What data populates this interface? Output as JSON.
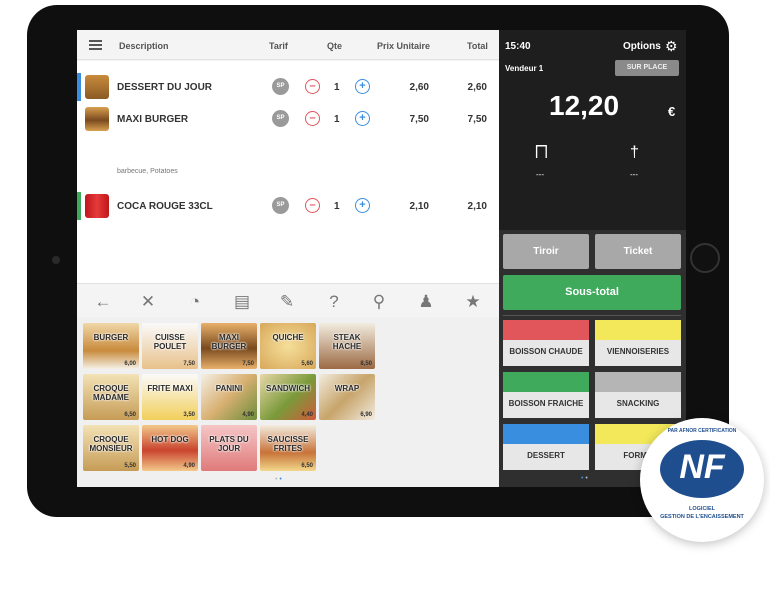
{
  "header": {
    "description": "Description",
    "tarif": "Tarif",
    "qte": "Qte",
    "prix_unitaire": "Prix Unitaire",
    "total": "Total"
  },
  "order": {
    "items": [
      {
        "name": "DESSERT DU JOUR",
        "tarif": "SP",
        "qty": "1",
        "unit": "2,60",
        "total": "2,60",
        "accent": "#3a8ee0"
      },
      {
        "name": "MAXI BURGER",
        "tarif": "SP",
        "qty": "1",
        "unit": "7,50",
        "total": "7,50",
        "note": "barbecue, Potatoes"
      },
      {
        "name": "COCA ROUGE 33CL",
        "tarif": "SP",
        "qty": "1",
        "unit": "2,10",
        "total": "2,10",
        "accent": "#3faa5c"
      }
    ]
  },
  "toolbar": [
    "arrow-left-icon",
    "close-icon",
    "timer-icon",
    "printer-icon",
    "pencil-icon",
    "question-icon",
    "search-icon",
    "person-icon",
    "star-icon"
  ],
  "products": [
    {
      "label": "BURGER",
      "price": "6,00"
    },
    {
      "label": "CUISSE POULET",
      "price": "7,50"
    },
    {
      "label": "MAXI BURGER",
      "price": "7,50"
    },
    {
      "label": "QUICHE",
      "price": "5,60"
    },
    {
      "label": "STEAK HACHE",
      "price": "8,50"
    },
    {
      "label": "CROQUE MADAME",
      "price": "6,50"
    },
    {
      "label": "FRITE MAXI",
      "price": "3,50"
    },
    {
      "label": "PANINI",
      "price": "4,90"
    },
    {
      "label": "SANDWICH",
      "price": "4,40"
    },
    {
      "label": "WRAP",
      "price": "6,90"
    },
    {
      "label": "CROQUE MONSIEUR",
      "price": "5,50"
    },
    {
      "label": "HOT DOG",
      "price": "4,90"
    },
    {
      "label": "PLATS DU JOUR",
      "price": ""
    },
    {
      "label": "SAUCISSE FRITES",
      "price": "6,50"
    }
  ],
  "right": {
    "time": "15:40",
    "options": "Options",
    "vendor": "Vendeur 1",
    "place": "SUR PLACE",
    "amount": "12,20",
    "currency": "€",
    "table_value": "---",
    "covers_value": "---",
    "tiroir": "Tiroir",
    "ticket": "Ticket",
    "sous_total": "Sous-total"
  },
  "categories": [
    {
      "label": "BOISSON CHAUDE",
      "color": "#e0565b"
    },
    {
      "label": "VIENNOISERIES",
      "color": "#f2e85a"
    },
    {
      "label": "BOISSON FRAICHE",
      "color": "#3faa5c"
    },
    {
      "label": "SNACKING",
      "color": "#b5b5b5"
    },
    {
      "label": "DESSERT",
      "color": "#3a8ee0"
    },
    {
      "label": "FORMU",
      "color": "#f2e85a"
    }
  ],
  "nf_badge": {
    "top": "PAR AFNOR CERTIFICATION",
    "logo": "NF",
    "line1": "LOGICIEL",
    "line2": "GESTION DE L'ENCAISSEMENT"
  }
}
